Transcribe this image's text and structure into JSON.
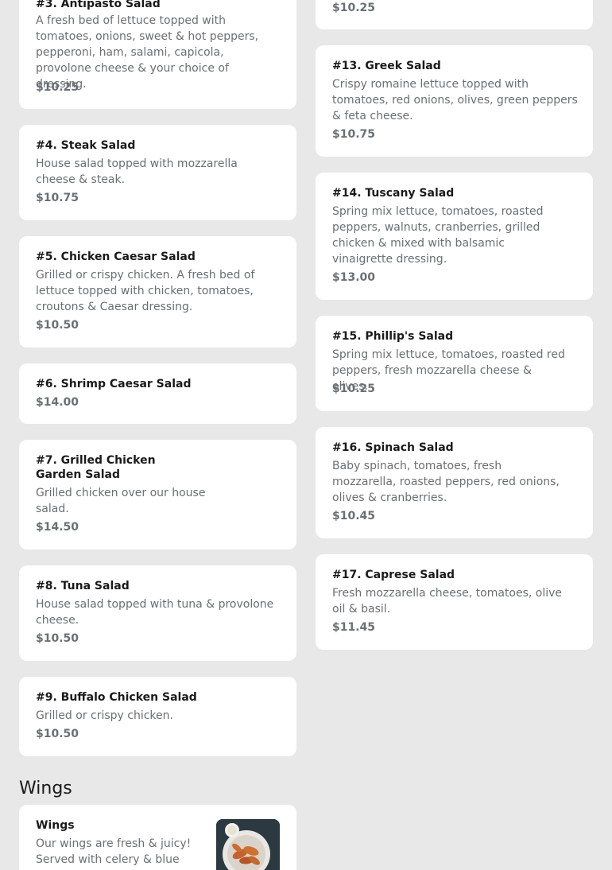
{
  "left_items": [
    {
      "name": "#3. Antipasto Salad",
      "desc": "A fresh bed of lettuce topped with tomatoes, onions, sweet & hot peppers, pepperoni, ham, salami, capicola, provolone cheese & your choice of dressing.",
      "price": "$10.25"
    },
    {
      "name": "#4. Steak Salad",
      "desc": "House salad topped with mozzarella cheese & steak.",
      "price": "$10.75"
    },
    {
      "name": "#5. Chicken Caesar Salad",
      "desc": "Grilled or crispy chicken. A fresh bed of lettuce topped with chicken, tomatoes, croutons & Caesar dressing.",
      "price": "$10.50"
    },
    {
      "name": "#6. Shrimp Caesar Salad",
      "desc": "",
      "price": "$14.00"
    },
    {
      "name": "#7. Grilled Chicken Garden Salad",
      "desc": "Grilled chicken over our house salad.",
      "price": "$14.50"
    },
    {
      "name": "#8. Tuna Salad",
      "desc": "House salad topped with tuna & provolone cheese.",
      "price": "$10.50"
    },
    {
      "name": "#9. Buffalo Chicken Salad",
      "desc": "Grilled or crispy chicken.",
      "price": "$10.50"
    }
  ],
  "right_items": [
    {
      "name": "",
      "desc": "",
      "price": "$10.25"
    },
    {
      "name": "#13. Greek Salad",
      "desc": "Crispy romaine lettuce topped with tomatoes, red onions, olives, green peppers & feta cheese.",
      "price": "$10.75"
    },
    {
      "name": "#14. Tuscany Salad",
      "desc": "Spring mix lettuce, tomatoes, roasted peppers, walnuts, cranberries, grilled chicken & mixed with balsamic vinaigrette dressing.",
      "price": "$13.00"
    },
    {
      "name": "#15. Phillip's Salad",
      "desc": "Spring mix lettuce, tomatoes, roasted red peppers, fresh mozzarella cheese & olives.",
      "price": "$10.25"
    },
    {
      "name": "#16. Spinach Salad",
      "desc": "Baby spinach, tomatoes, fresh mozzarella, roasted peppers, red onions, olives & cranberries.",
      "price": "$10.45"
    },
    {
      "name": "#17. Caprese Salad",
      "desc": "Fresh mozzarella cheese, tomatoes, olive oil & basil.",
      "price": "$11.45"
    }
  ],
  "wings_section": {
    "title": "Wings",
    "item": {
      "name": "Wings",
      "desc": "Our wings are fresh & juicy! Served with celery & blue"
    }
  }
}
